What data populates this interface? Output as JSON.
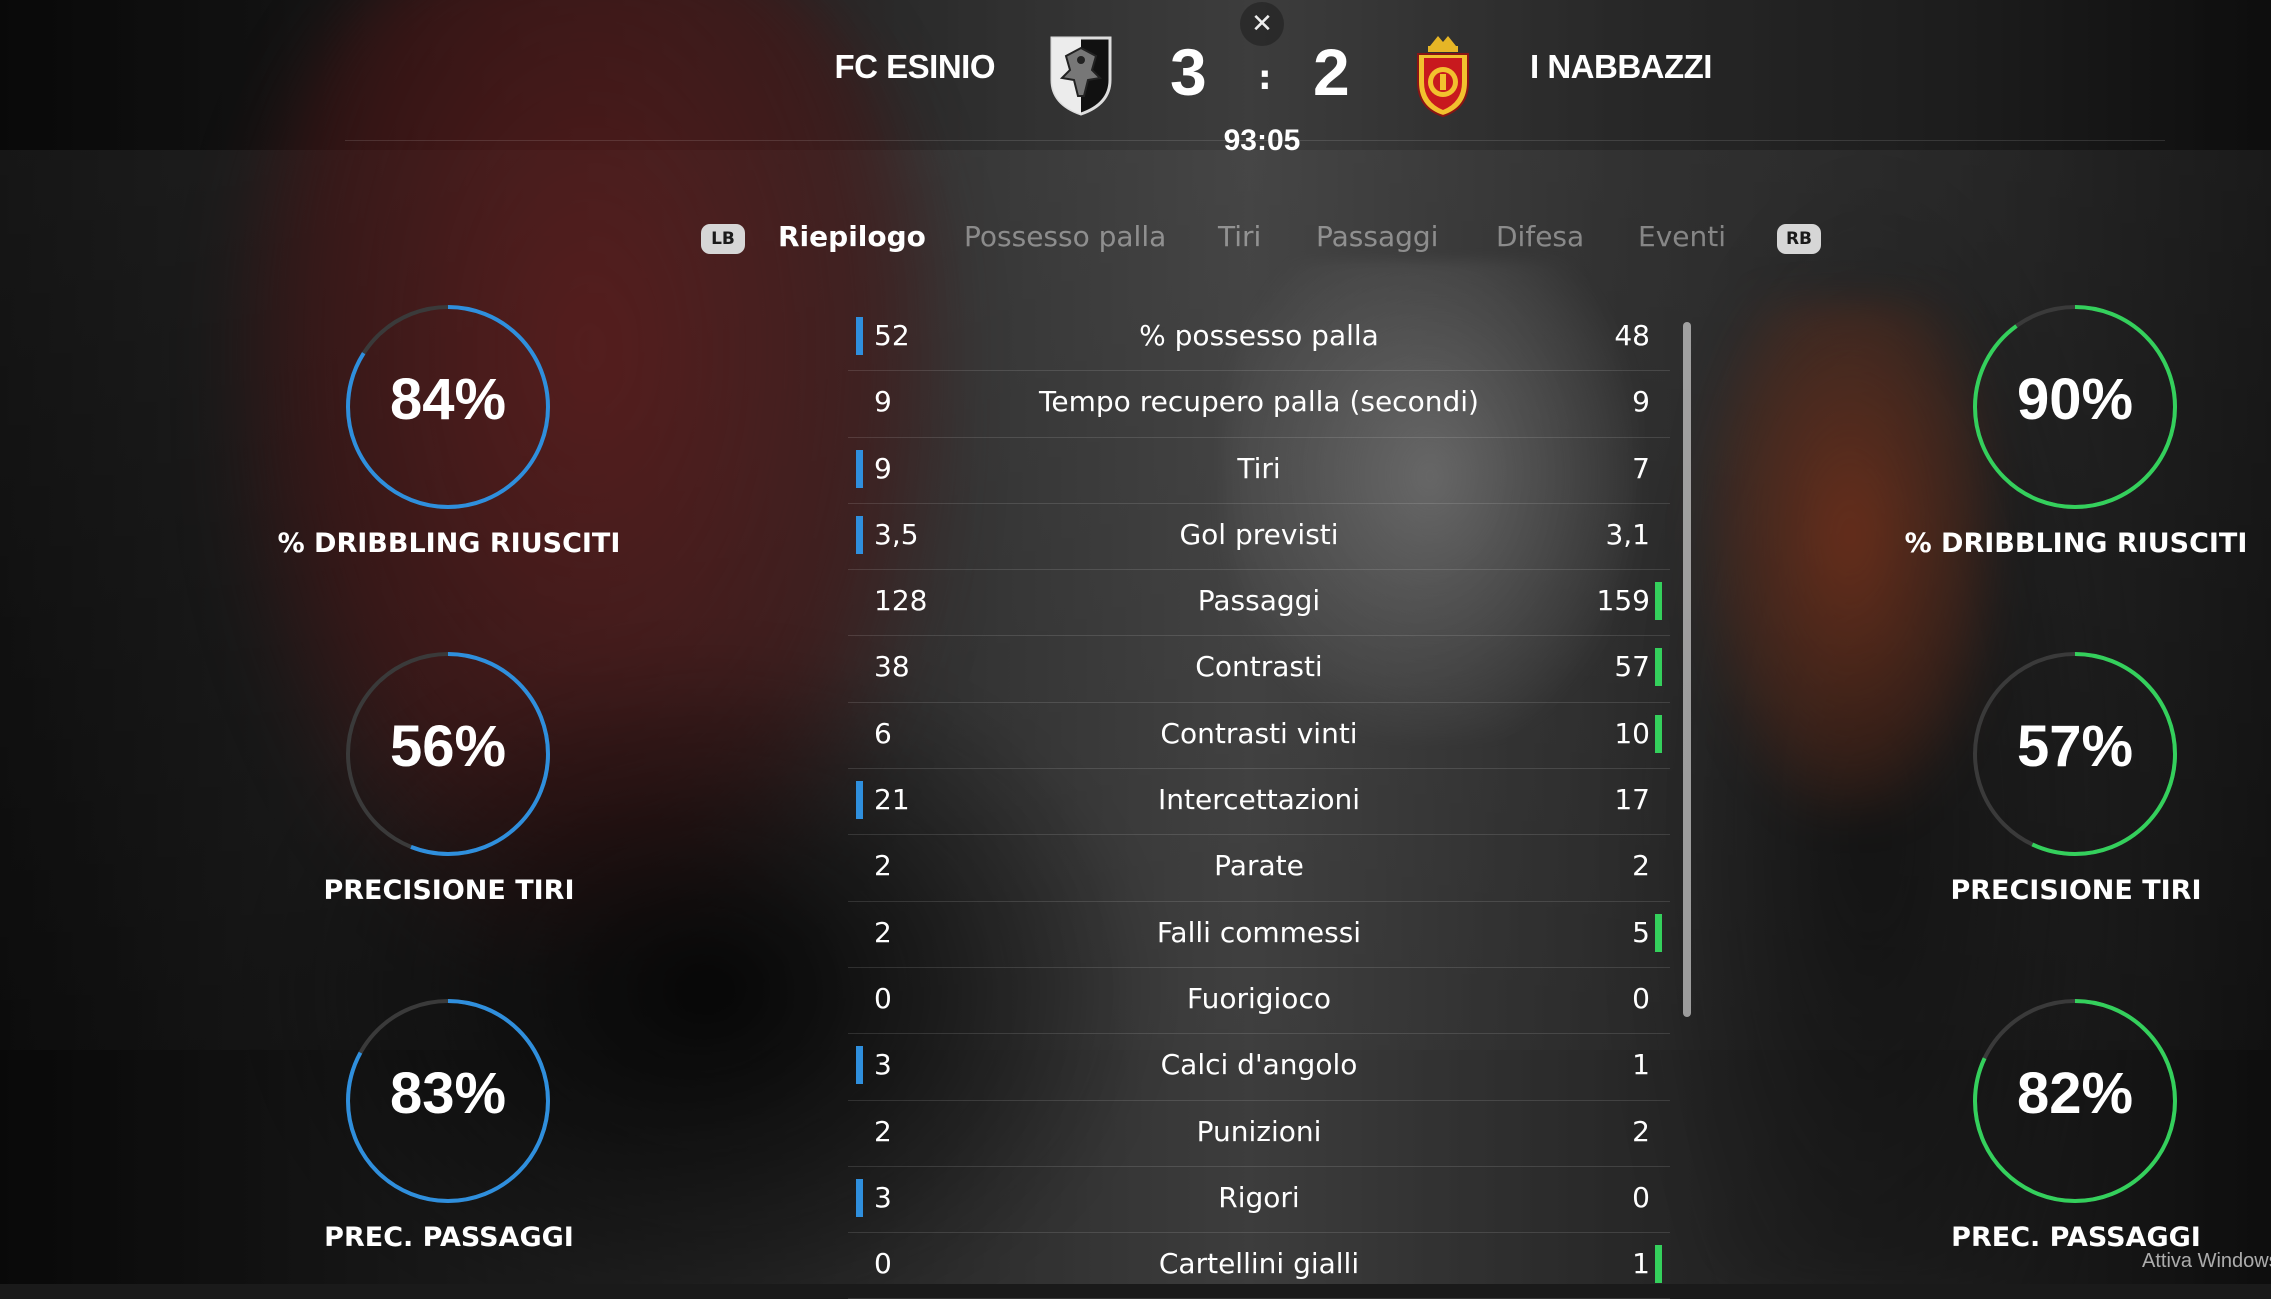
{
  "header": {
    "home_team": "FC ESINIO",
    "away_team": "I NABBAZZI",
    "home_score": "3",
    "away_score": "2",
    "separator": ":",
    "match_time": "93:05",
    "close_icon": "close-icon"
  },
  "tabs": {
    "left_bumper": "LB",
    "right_bumper": "RB",
    "items": [
      {
        "label": "Riepilogo",
        "active": true
      },
      {
        "label": "Possesso palla",
        "active": false
      },
      {
        "label": "Tiri",
        "active": false
      },
      {
        "label": "Passaggi",
        "active": false
      },
      {
        "label": "Difesa",
        "active": false
      },
      {
        "label": "Eventi",
        "active": false
      }
    ]
  },
  "stats": [
    {
      "home": "52",
      "label": "% possesso palla",
      "away": "48",
      "leader": "home"
    },
    {
      "home": "9",
      "label": "Tempo recupero palla (secondi)",
      "away": "9",
      "leader": "none"
    },
    {
      "home": "9",
      "label": "Tiri",
      "away": "7",
      "leader": "home"
    },
    {
      "home": "3,5",
      "label": "Gol previsti",
      "away": "3,1",
      "leader": "home"
    },
    {
      "home": "128",
      "label": "Passaggi",
      "away": "159",
      "leader": "away"
    },
    {
      "home": "38",
      "label": "Contrasti",
      "away": "57",
      "leader": "away"
    },
    {
      "home": "6",
      "label": "Contrasti vinti",
      "away": "10",
      "leader": "away"
    },
    {
      "home": "21",
      "label": "Intercettazioni",
      "away": "17",
      "leader": "home"
    },
    {
      "home": "2",
      "label": "Parate",
      "away": "2",
      "leader": "none"
    },
    {
      "home": "2",
      "label": "Falli commessi",
      "away": "5",
      "leader": "away"
    },
    {
      "home": "0",
      "label": "Fuorigioco",
      "away": "0",
      "leader": "none"
    },
    {
      "home": "3",
      "label": "Calci d'angolo",
      "away": "1",
      "leader": "home"
    },
    {
      "home": "2",
      "label": "Punizioni",
      "away": "2",
      "leader": "none"
    },
    {
      "home": "3",
      "label": "Rigori",
      "away": "0",
      "leader": "home"
    },
    {
      "home": "0",
      "label": "Cartellini gialli",
      "away": "1",
      "leader": "away"
    }
  ],
  "rings": {
    "home": [
      {
        "value": "84%",
        "fraction": 0.84,
        "label": "% DRIBBLING RIUSCITI"
      },
      {
        "value": "56%",
        "fraction": 0.56,
        "label": "PRECISIONE TIRI"
      },
      {
        "value": "83%",
        "fraction": 0.83,
        "label": "PREC. PASSAGGI"
      }
    ],
    "away": [
      {
        "value": "90%",
        "fraction": 0.9,
        "label": "% DRIBBLING RIUSCITI"
      },
      {
        "value": "57%",
        "fraction": 0.57,
        "label": "PRECISIONE TIRI"
      },
      {
        "value": "82%",
        "fraction": 0.82,
        "label": "PREC. PASSAGGI"
      }
    ]
  },
  "colors": {
    "home_accent": "#2f8fdd",
    "away_accent": "#34d05c",
    "ring_track": "#3a3a3a"
  },
  "watermark": "Attiva Windows"
}
